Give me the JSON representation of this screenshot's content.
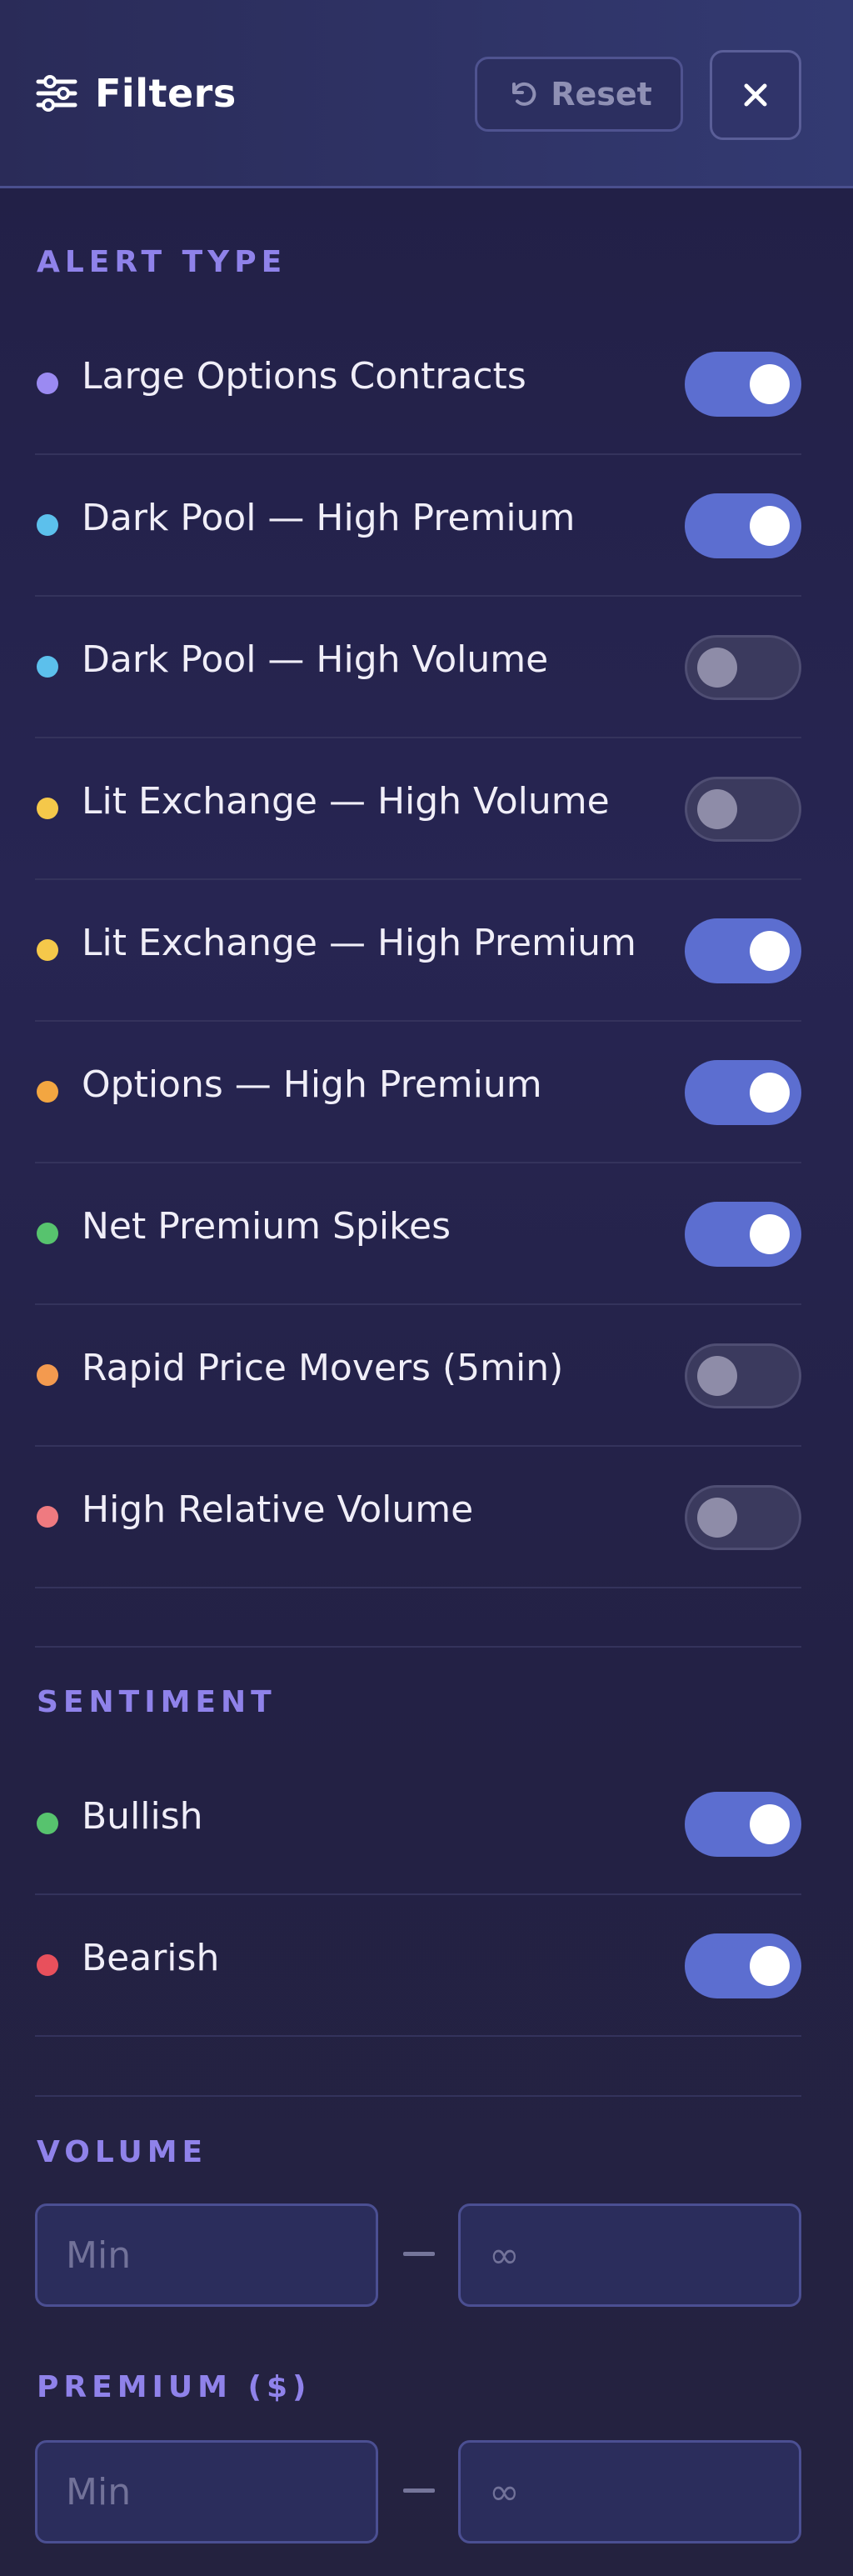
{
  "header": {
    "title": "Filters",
    "icon": "sliders-icon",
    "reset_label": "Reset",
    "reset_icon": "undo-icon",
    "close_icon": "close-icon"
  },
  "colors": {
    "accent": "#5c6ed0",
    "section_title": "#8f82ea",
    "toggle_on": "#5c6ed0",
    "toggle_off": "#3b3a5e"
  },
  "alert_type": {
    "title": "ALERT TYPE",
    "items": [
      {
        "label": "Large Options Contracts",
        "dot_color": "#9b8af2",
        "enabled": true
      },
      {
        "label": "Dark Pool — High Premium",
        "dot_color": "#5cc0ec",
        "enabled": true
      },
      {
        "label": "Dark Pool — High Volume",
        "dot_color": "#5cc0ec",
        "enabled": false
      },
      {
        "label": "Lit Exchange — High Volume",
        "dot_color": "#f5c84a",
        "enabled": false
      },
      {
        "label": "Lit Exchange — High Premium",
        "dot_color": "#f5c84a",
        "enabled": true
      },
      {
        "label": "Options — High Premium",
        "dot_color": "#f3a641",
        "enabled": true
      },
      {
        "label": "Net Premium Spikes",
        "dot_color": "#57c36e",
        "enabled": true
      },
      {
        "label": "Rapid Price Movers (5min)",
        "dot_color": "#f39a4f",
        "enabled": false
      },
      {
        "label": "High Relative Volume",
        "dot_color": "#ef7a80",
        "enabled": false
      }
    ]
  },
  "sentiment": {
    "title": "SENTIMENT",
    "items": [
      {
        "label": "Bullish",
        "dot_color": "#57c36e",
        "enabled": true
      },
      {
        "label": "Bearish",
        "dot_color": "#e8505c",
        "enabled": true
      }
    ]
  },
  "volume": {
    "title": "VOLUME",
    "min_placeholder": "Min",
    "max_placeholder": "∞",
    "min_value": "",
    "max_value": ""
  },
  "premium": {
    "title": "PREMIUM ($)",
    "min_placeholder": "Min",
    "max_placeholder": "∞",
    "min_value": "",
    "max_value": ""
  }
}
